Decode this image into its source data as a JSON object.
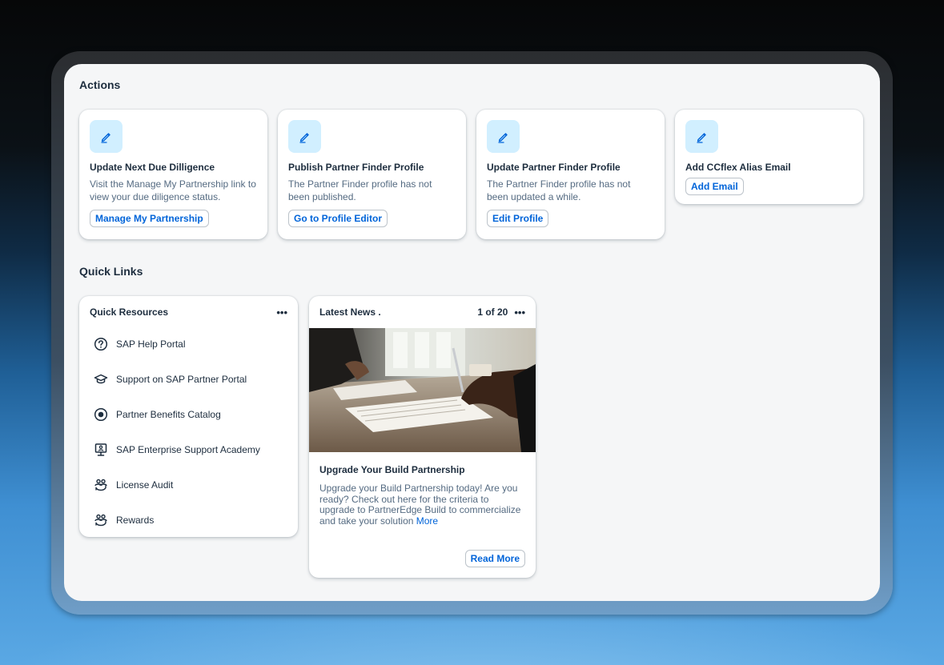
{
  "actions": {
    "title": "Actions",
    "cards": [
      {
        "title": "Update Next Due Dilligence",
        "description": "Visit the Manage My Partnership link to view your due diligence status.",
        "button": "Manage My Partnership",
        "icon": "edit-icon"
      },
      {
        "title": "Publish Partner Finder Profile",
        "description": "The Partner Finder profile has not been published.",
        "button": "Go to Profile Editor",
        "icon": "edit-icon"
      },
      {
        "title": "Update Partner Finder Profile",
        "description": "The Partner Finder profile has not been updated a while.",
        "button": "Edit Profile",
        "icon": "edit-icon"
      },
      {
        "title": "Add CCflex Alias Email",
        "description": "",
        "button": "Add Email",
        "icon": "edit-icon"
      }
    ]
  },
  "quick_links": {
    "title": "Quick Links",
    "resources": {
      "title": "Quick Resources",
      "more": "•••",
      "items": [
        {
          "label": "SAP Help Portal",
          "icon": "question-circle-icon"
        },
        {
          "label": "Support on SAP Partner Portal",
          "icon": "graduation-cap-icon"
        },
        {
          "label": "Partner Benefits Catalog",
          "icon": "radio-target-icon"
        },
        {
          "label": "SAP Enterprise Support Academy",
          "icon": "monitor-person-icon"
        },
        {
          "label": "License Audit",
          "icon": "people-cycle-icon"
        },
        {
          "label": "Rewards",
          "icon": "people-cycle-icon"
        }
      ]
    },
    "news": {
      "title": "Latest News .",
      "pager": "1 of 20",
      "more": "•••",
      "headline": "Upgrade Your Build Partnership",
      "text": "Upgrade your Build Partnership today! Are you ready? Check out here for the criteria to upgrade to PartnerEdge Build to commercialize and take your solution ",
      "more_link": "More",
      "read_more": "Read More"
    }
  },
  "colors": {
    "accent": "#0064d9",
    "icon_tile_bg": "#d1efff",
    "text": "#1d2d3e",
    "muted_text": "#556b82"
  }
}
